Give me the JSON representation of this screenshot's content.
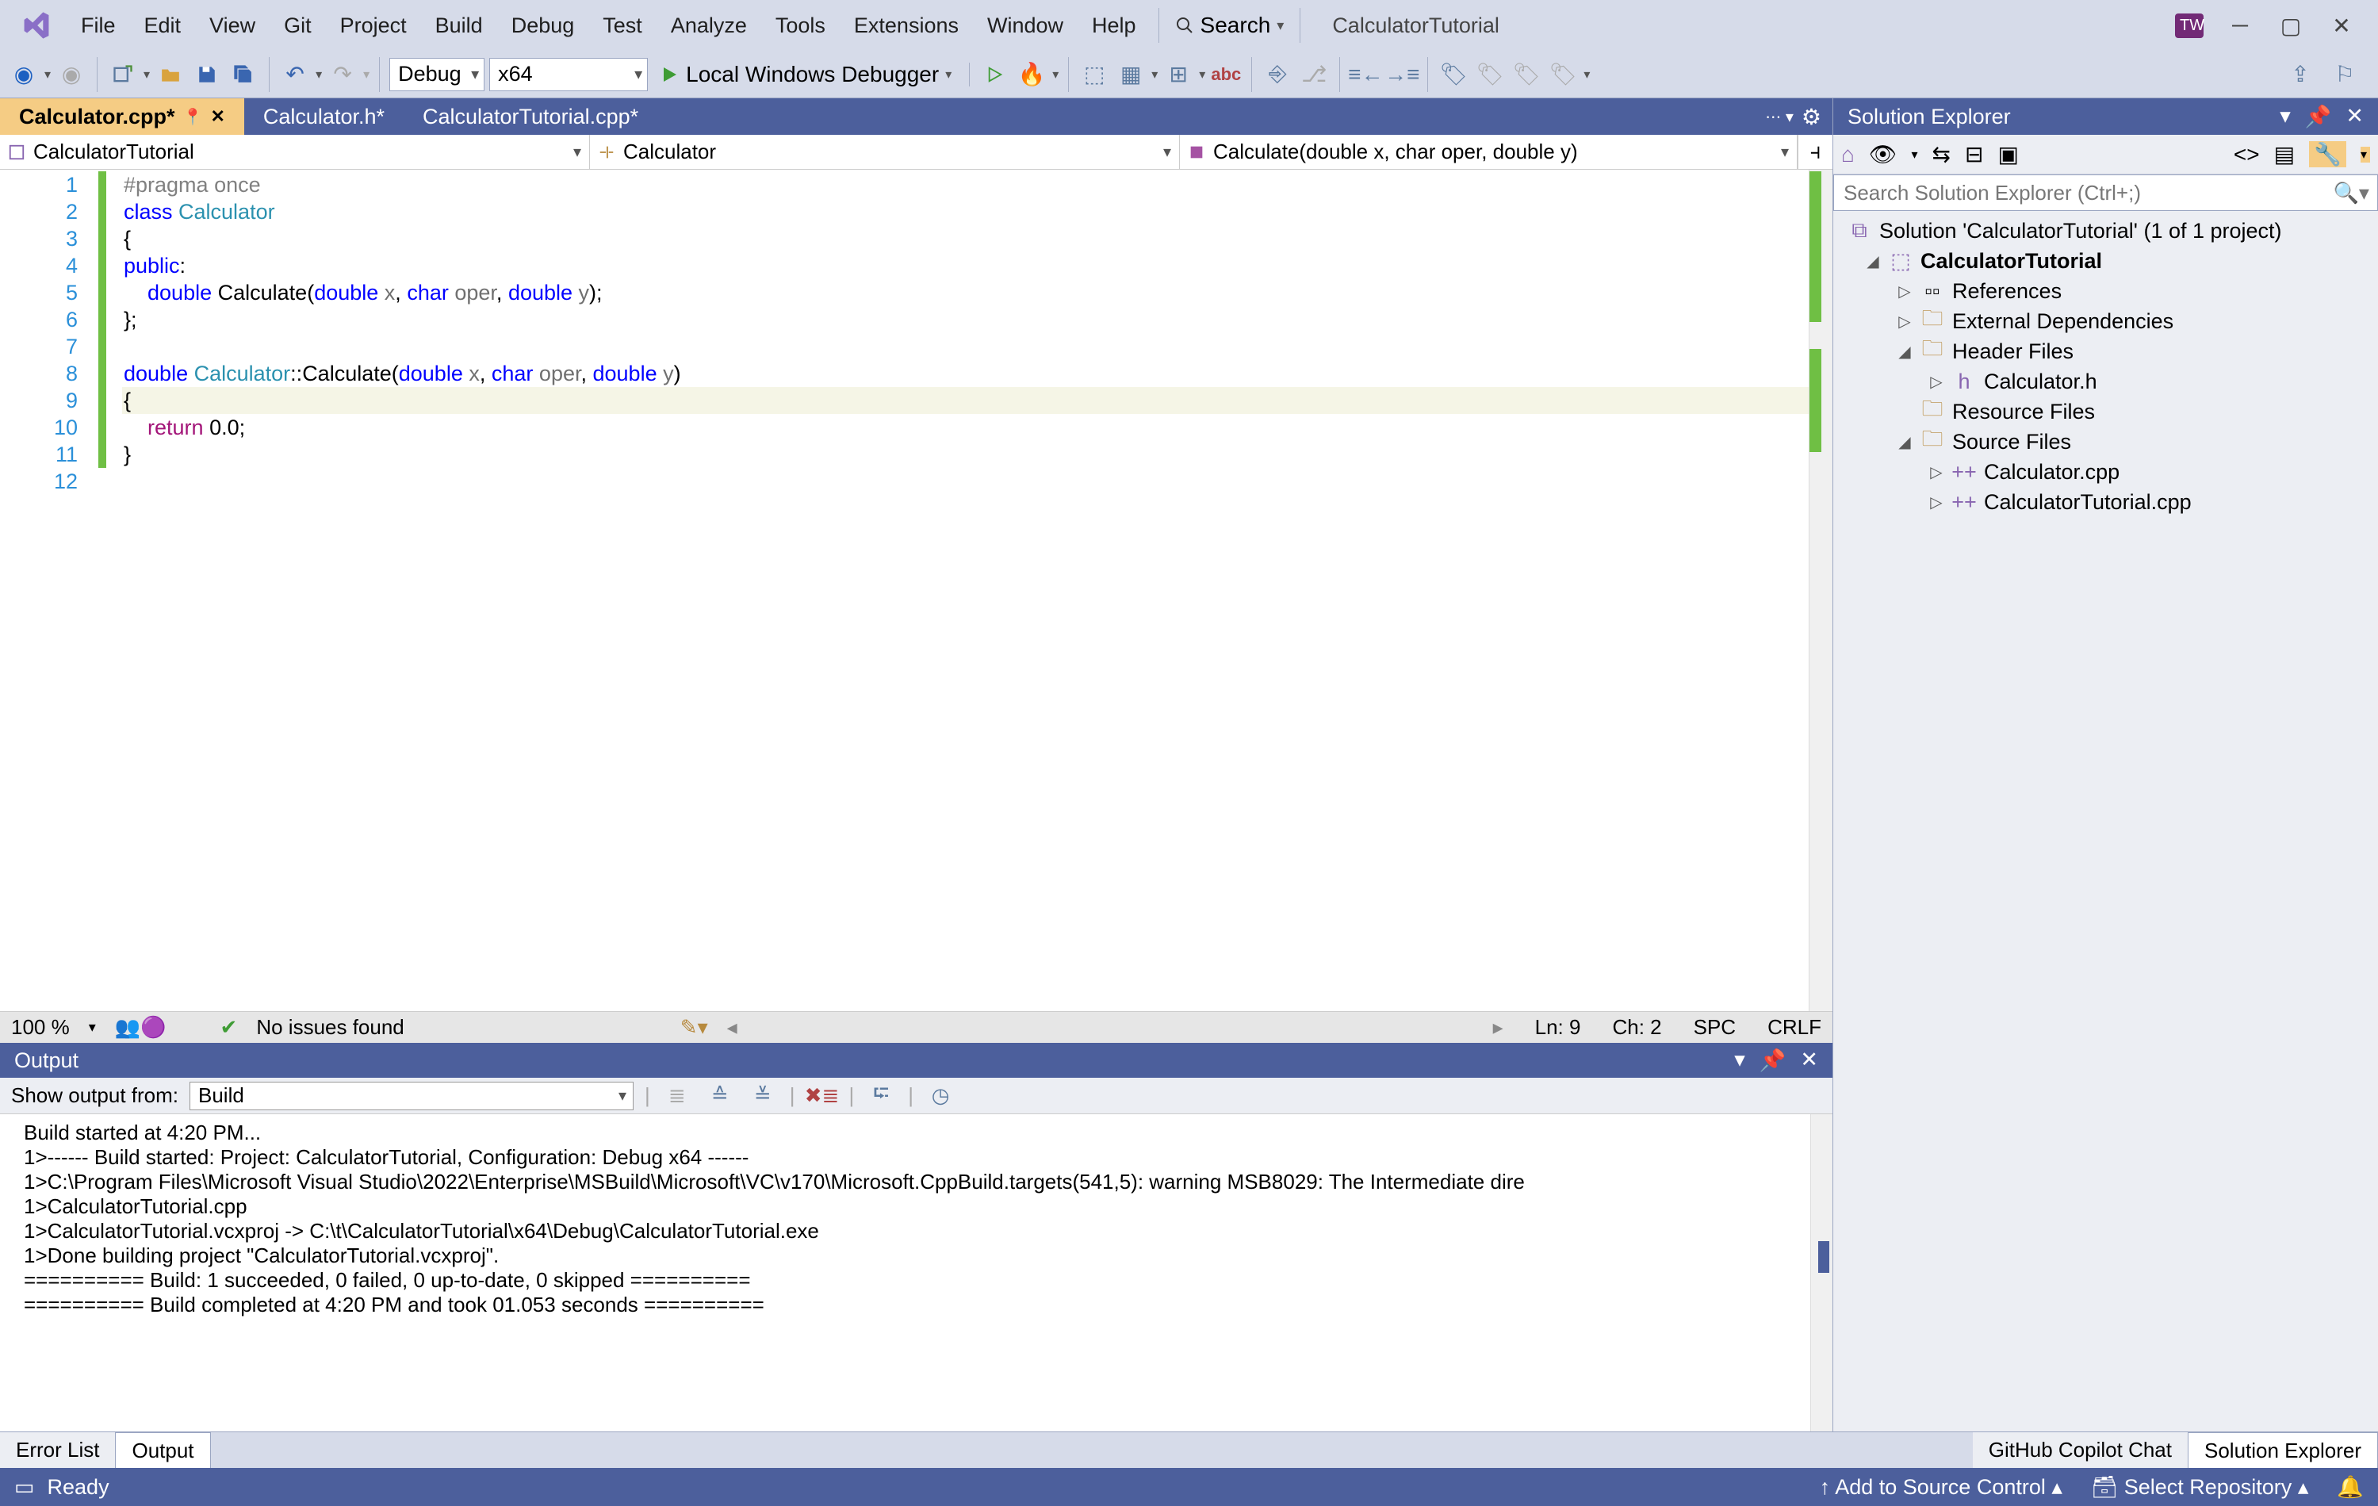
{
  "app": {
    "title": "CalculatorTutorial",
    "search_label": "Search"
  },
  "menu": [
    "File",
    "Edit",
    "View",
    "Git",
    "Project",
    "Build",
    "Debug",
    "Test",
    "Analyze",
    "Tools",
    "Extensions",
    "Window",
    "Help"
  ],
  "toolbar": {
    "config": "Debug",
    "platform": "x64",
    "debugger": "Local Windows Debugger"
  },
  "tabs": [
    {
      "label": "Calculator.cpp*",
      "active": true
    },
    {
      "label": "Calculator.h*",
      "active": false
    },
    {
      "label": "CalculatorTutorial.cpp*",
      "active": false
    }
  ],
  "nav": {
    "scope": "CalculatorTutorial",
    "class": "Calculator",
    "member": "Calculate(double x, char oper, double y)"
  },
  "code": {
    "lines": [
      {
        "n": 1,
        "html": "<span class='pre'>#pragma once</span>"
      },
      {
        "n": 2,
        "html": "<span class='kw'>class</span> <span class='typ'>Calculator</span>",
        "fold": true
      },
      {
        "n": 3,
        "html": "{"
      },
      {
        "n": 4,
        "html": "<span class='kw'>public</span>:"
      },
      {
        "n": 5,
        "html": "    <span class='kw'>double</span> <span>Calculate</span>(<span class='kw'>double</span> <span class='var'>x</span>, <span class='kw'>char</span> <span class='var'>oper</span>, <span class='kw'>double</span> <span class='var'>y</span>);"
      },
      {
        "n": 6,
        "html": "};"
      },
      {
        "n": 7,
        "html": ""
      },
      {
        "n": 8,
        "html": "<span class='kw'>double</span> <span class='typ'>Calculator</span>::<span>Calculate</span>(<span class='kw'>double</span> <span class='var'>x</span>, <span class='kw'>char</span> <span class='var'>oper</span>, <span class='kw'>double</span> <span class='var'>y</span>)",
        "fold": true
      },
      {
        "n": 9,
        "html": "{",
        "hl": true
      },
      {
        "n": 10,
        "html": "    <span class='ret'>return</span> 0.0;"
      },
      {
        "n": 11,
        "html": "}"
      },
      {
        "n": 12,
        "html": ""
      }
    ]
  },
  "editor_status": {
    "zoom": "100 %",
    "issues": "No issues found",
    "ln": "Ln: 9",
    "ch": "Ch: 2",
    "spc": "SPC",
    "eol": "CRLF"
  },
  "output": {
    "title": "Output",
    "from_label": "Show output from:",
    "source": "Build",
    "text": "Build started at 4:20 PM...\n1>------ Build started: Project: CalculatorTutorial, Configuration: Debug x64 ------\n1>C:\\Program Files\\Microsoft Visual Studio\\2022\\Enterprise\\MSBuild\\Microsoft\\VC\\v170\\Microsoft.CppBuild.targets(541,5): warning MSB8029: The Intermediate dire\n1>CalculatorTutorial.cpp\n1>CalculatorTutorial.vcxproj -> C:\\t\\CalculatorTutorial\\x64\\Debug\\CalculatorTutorial.exe\n1>Done building project \"CalculatorTutorial.vcxproj\".\n========== Build: 1 succeeded, 0 failed, 0 up-to-date, 0 skipped ==========\n========== Build completed at 4:20 PM and took 01.053 seconds =========="
  },
  "solution": {
    "title": "Solution Explorer",
    "search_placeholder": "Search Solution Explorer (Ctrl+;)",
    "root": "Solution 'CalculatorTutorial' (1 of 1 project)",
    "project": "CalculatorTutorial",
    "refs": "References",
    "ext": "External Dependencies",
    "header_folder": "Header Files",
    "header_file": "Calculator.h",
    "resource_folder": "Resource Files",
    "source_folder": "Source Files",
    "src1": "Calculator.cpp",
    "src2": "CalculatorTutorial.cpp"
  },
  "bottom_tabs": {
    "error_list": "Error List",
    "output": "Output",
    "copilot": "GitHub Copilot Chat",
    "sol_exp": "Solution Explorer"
  },
  "status": {
    "ready": "Ready",
    "add_sc": "Add to Source Control",
    "select_repo": "Select Repository"
  }
}
